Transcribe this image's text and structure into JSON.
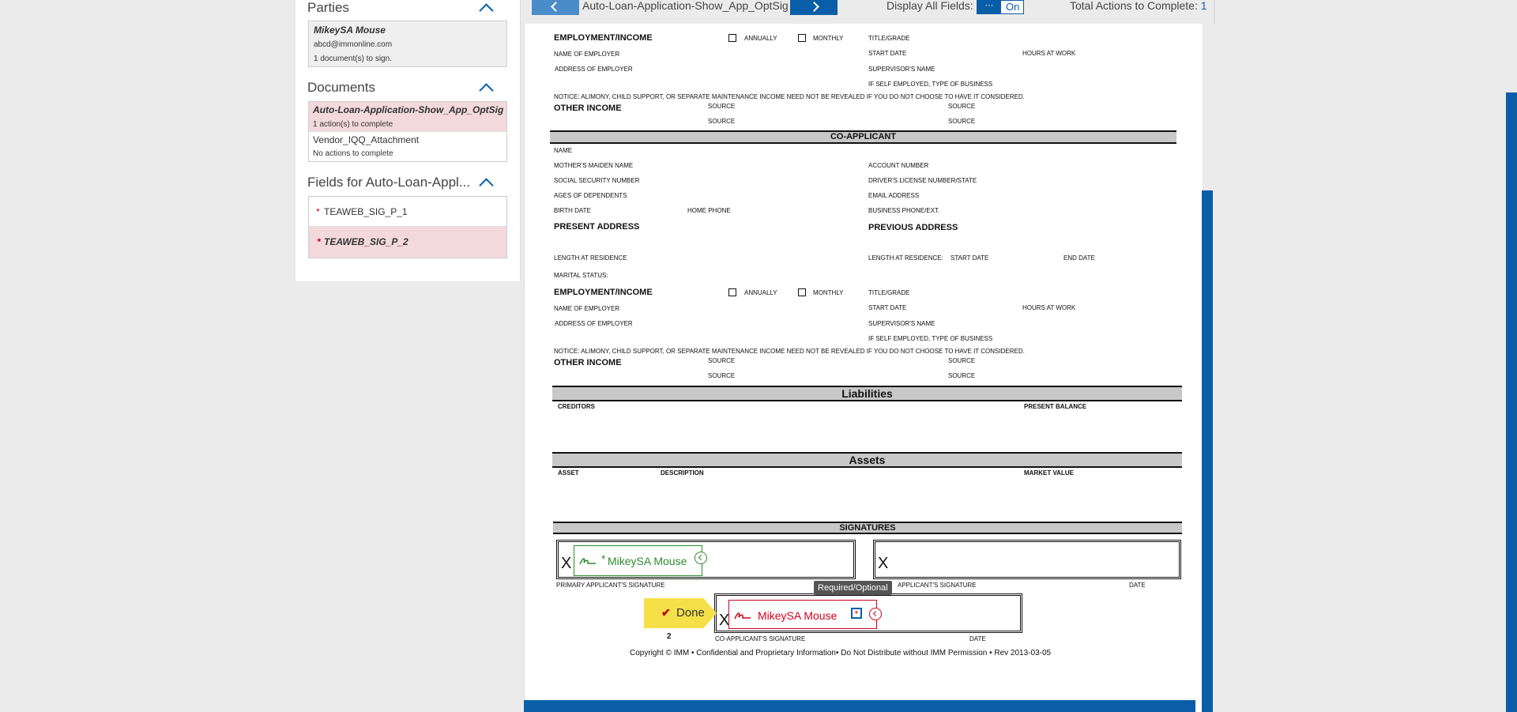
{
  "sidebar": {
    "parties": {
      "title": "Parties",
      "name": "MikeySA Mouse",
      "email": "abcd@immonline.com",
      "docs_to_sign": "1 document(s) to sign."
    },
    "documents": {
      "title": "Documents",
      "items": [
        {
          "name": "Auto-Loan-Application-Show_App_OptSig",
          "status": "1 action(s) to complete"
        },
        {
          "name": "Vendor_IQQ_Attachment",
          "status": "No actions to complete"
        }
      ]
    },
    "fields": {
      "title": "Fields for Auto-Loan-Appl...",
      "items": [
        {
          "star": "*",
          "label": "TEAWEB_SIG_P_1"
        },
        {
          "star": "*",
          "label": "TEAWEB_SIG_P_2"
        }
      ]
    }
  },
  "topbar": {
    "doc_name": "Auto-Loan-Application-Show_App_OptSig",
    "display_all_label": "Display All Fields:",
    "toggle_dots": "···",
    "toggle_state": "On",
    "total_actions_label": "Total Actions to Complete:",
    "total_actions_value": "1"
  },
  "form": {
    "employment_income": "EMPLOYMENT/INCOME",
    "annually": "ANNUALLY",
    "monthly": "MONTHLY",
    "title_grade": "TITLE/GRADE",
    "name_of_employer": "NAME OF EMPLOYER",
    "start_date": "START DATE",
    "hours_at_work": "HOURS AT WORK",
    "address_of_employer": "ADDRESS OF EMPLOYER",
    "supervisors_name": "SUPERVISOR'S NAME",
    "if_self_employed": "IF SELF EMPLOYED, TYPE OF BUSINESS",
    "notice": "NOTICE: ALIMONY, CHILD SUPPORT, OR SEPARATE MAINTENANCE INCOME NEED NOT BE REVEALED IF YOU DO NOT CHOOSE TO HAVE IT CONSIDERED.",
    "other_income": "OTHER INCOME",
    "source": "SOURCE",
    "co_applicant": "CO-APPLICANT",
    "name": "NAME",
    "mothers_maiden": "MOTHER'S MAIDEN NAME",
    "account_number": "ACCOUNT NUMBER",
    "ssn": "SOCIAL SECURITY NUMBER",
    "drivers_license": "DRIVER'S LICENSE NUMBER/STATE",
    "ages_dependents": "AGES OF DEPENDENTS",
    "email_address": "EMAIL ADDRESS",
    "birth_date": "BIRTH DATE",
    "home_phone": "HOME PHONE",
    "business_phone": "BUSINESS PHONE/EXT.",
    "present_address": "PRESENT ADDRESS",
    "previous_address": "PREVIOUS ADDRESS",
    "length_residence": "LENGTH AT RESIDENCE",
    "length_residence2": "LENGTH AT RESIDENCE:",
    "end_date": "END DATE",
    "marital_status": "MARITAL STATUS:",
    "liabilities": "Liabilities",
    "creditors": "CREDITORS",
    "present_balance": "PRESENT BALANCE",
    "assets": "Assets",
    "asset": "ASSET",
    "description": "DESCRIPTION",
    "market_value": "MARKET VALUE",
    "signatures": "SIGNATURES",
    "x": "X",
    "primary_sig": "PRIMARY APPLICANT'S SIGNATURE",
    "date": "DATE",
    "applicant_sig": "APPLICANT'S SIGNATURE",
    "co_app_sig": "CO-APPLICANT'S SIGNATURE",
    "copyright": "Copyright © IMM • Confidential and Proprietary Information• Do Not Distribute without IMM Permission • Rev 2013-03-05"
  },
  "sigfields": {
    "first": {
      "star": "*",
      "name": "MikeySA Mouse"
    },
    "second": {
      "name": "MikeySA Mouse",
      "star": "*"
    },
    "tooltip": "Required/Optional",
    "done": "Done",
    "step": "2"
  },
  "colors": {
    "accent": "#0a5ea8",
    "signed_green": "#2e8b2e",
    "required_red": "#d0021b",
    "done_yellow": "#f5e04a"
  }
}
